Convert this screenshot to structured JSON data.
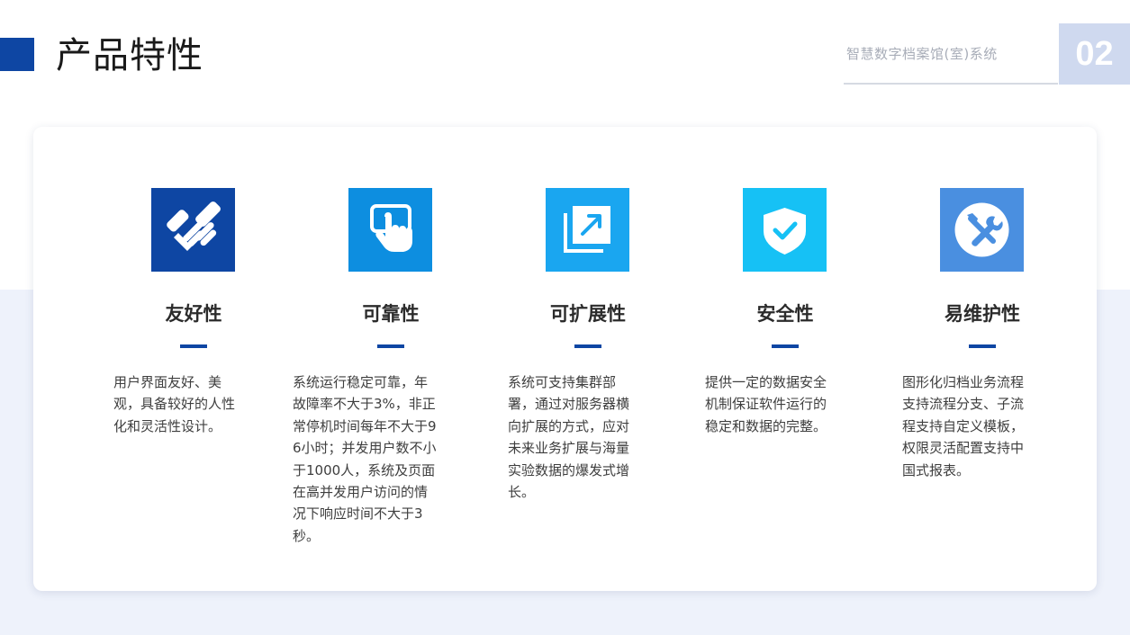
{
  "header": {
    "title": "产品特性",
    "system_name": "智慧数字档案馆(室)系统",
    "page_number": "02"
  },
  "colors": {
    "brand": "#0e46a3",
    "band": "#eef2fb",
    "page_num_bg": "#cfd9ef"
  },
  "features": [
    {
      "title": "友好性",
      "icon": "handshake-icon",
      "color": "#0e46a3",
      "description": "用户界面友好、美观，具备较好的人性化和灵活性设计。"
    },
    {
      "title": "可靠性",
      "icon": "touch-hand-icon",
      "color": "#0d8ee0",
      "description": "系统运行稳定可靠，年故障率不大于3%，非正常停机时间每年不大于96小时；并发用户数不小于1000人，系统及页面在高并发用户访问的情况下响应时间不大于3秒。"
    },
    {
      "title": "可扩展性",
      "icon": "expand-icon",
      "color": "#1aa6f0",
      "description": "系统可支持集群部署，通过对服务器横向扩展的方式，应对未来业务扩展与海量实验数据的爆发式增长。"
    },
    {
      "title": "安全性",
      "icon": "shield-check-icon",
      "color": "#16c1f5",
      "description": "提供一定的数据安全机制保证软件运行的稳定和数据的完整。"
    },
    {
      "title": "易维护性",
      "icon": "tools-icon",
      "color": "#4a8fe0",
      "description": "图形化归档业务流程支持流程分支、子流程支持自定义模板，权限灵活配置支持中国式报表。"
    }
  ]
}
